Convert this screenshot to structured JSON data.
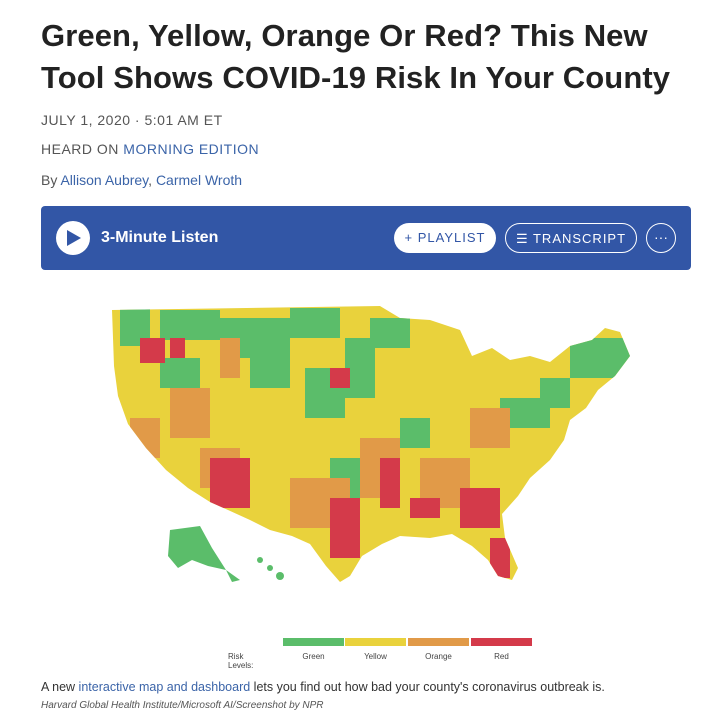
{
  "article": {
    "headline": "Green, Yellow, Orange Or Red? This New Tool Shows COVID-19 Risk In Your County",
    "dateline": "JULY 1, 2020 · 5:01 AM ET",
    "heard_prefix": "HEARD ON",
    "heard_program": "MORNING EDITION",
    "by_prefix": "By",
    "author1": "Allison Aubrey",
    "author_sep": ",",
    "author2": "Carmel Wroth"
  },
  "player": {
    "listen_label": "3-Minute Listen",
    "playlist_label": "+ PLAYLIST",
    "transcript_label": "☰ TRANSCRIPT",
    "more_label": "···"
  },
  "map": {
    "legend_title": "Risk Levels:",
    "levels": [
      {
        "label": "Green",
        "color": "#5bbd6a"
      },
      {
        "label": "Yellow",
        "color": "#e9d23c"
      },
      {
        "label": "Orange",
        "color": "#e19a48"
      },
      {
        "label": "Red",
        "color": "#d43a4a"
      }
    ]
  },
  "caption": {
    "text_before": "A new",
    "link_text": "interactive map and dashboard",
    "text_after": "lets you find out how bad your county's coronavirus outbreak is.",
    "credit": "Harvard Global Health Institute/Microsoft AI/Screenshot by NPR"
  },
  "colors": {
    "accent_blue": "#3256a6",
    "link_blue": "#3b64a8"
  }
}
